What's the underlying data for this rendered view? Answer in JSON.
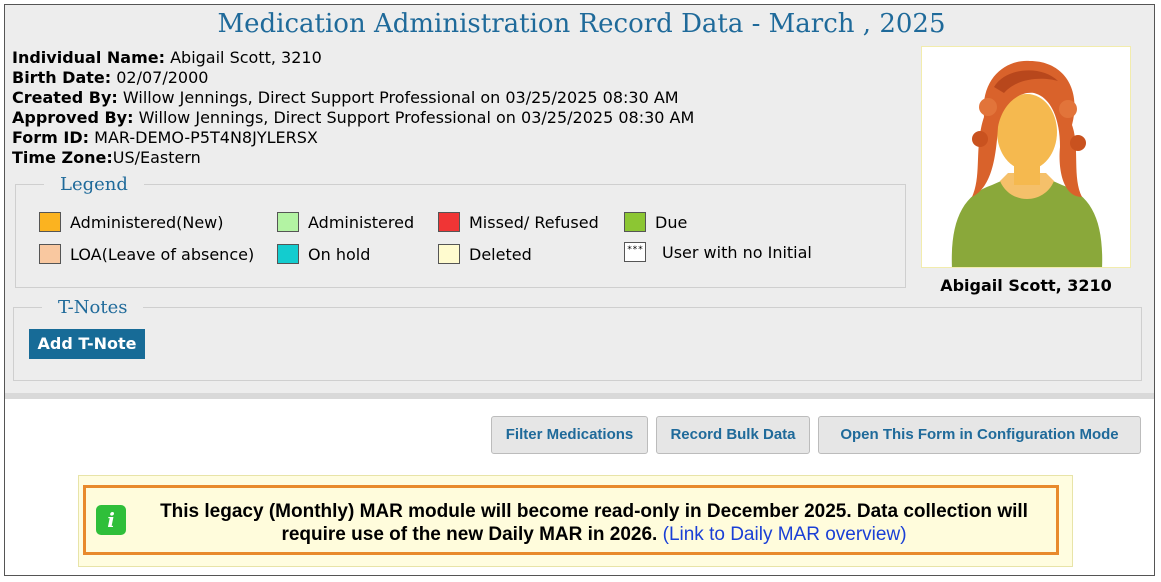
{
  "header": {
    "title": "Medication Administration Record Data - March , 2025"
  },
  "info": {
    "individual_name_label": "Individual Name:",
    "individual_name_value": " Abigail Scott, 3210",
    "birth_date_label": "Birth Date:",
    "birth_date_value": " 02/07/2000",
    "created_by_label": "Created By:",
    "created_by_value": " Willow Jennings, Direct Support Professional on 03/25/2025 08:30 AM",
    "approved_by_label": "Approved By:",
    "approved_by_value": " Willow Jennings, Direct Support Professional on 03/25/2025 08:30 AM",
    "form_id_label": "Form ID:",
    "form_id_value": " MAR-DEMO-P5T4N8JYLERSX",
    "time_zone_label": "Time Zone:",
    "time_zone_value": "US/Eastern"
  },
  "photo": {
    "caption": "Abigail Scott, 3210"
  },
  "legend": {
    "title": "Legend",
    "items": [
      {
        "label": "Administered(New)",
        "color": "#fbb320"
      },
      {
        "label": "Administered",
        "color": "#b3f3a3"
      },
      {
        "label": "Missed/ Refused",
        "color": "#f03535"
      },
      {
        "label": "Due",
        "color": "#8cc633"
      },
      {
        "label": "LOA(Leave of absence)",
        "color": "#f9c8a0"
      },
      {
        "label": "On hold",
        "color": "#13cccf"
      },
      {
        "label": "Deleted",
        "color": "#fffbcf"
      },
      {
        "label": "User with no Initial",
        "color": "#ffffff",
        "swatch_text": "***"
      }
    ]
  },
  "tnotes": {
    "title": "T-Notes",
    "add_button": "Add T-Note"
  },
  "actions": {
    "filter": "Filter Medications",
    "bulk": "Record Bulk Data",
    "config": "Open This Form in Configuration Mode"
  },
  "notice": {
    "icon": "info-icon",
    "text": "This legacy (Monthly) MAR module will become read-only in December 2025. Data collection will require use of the new Daily MAR in 2026.",
    "link": "(Link to Daily MAR overview)"
  }
}
